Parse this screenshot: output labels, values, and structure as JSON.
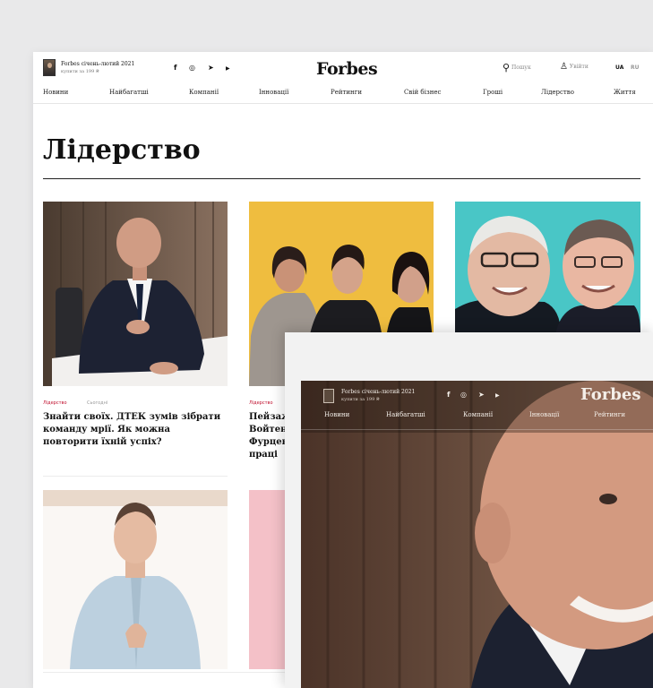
{
  "promo": {
    "title": "Forbes січень-лютий 2021",
    "subtitle": "купити за 199 ₴"
  },
  "social": {
    "facebook": "f",
    "instagram": "◎",
    "telegram": "➤",
    "youtube": "▶"
  },
  "logo": "Forbes",
  "search": {
    "icon": "search-icon",
    "label": "Пошук"
  },
  "login": {
    "icon": "user-icon",
    "label": "Увійти"
  },
  "lang": {
    "active": "UA",
    "other": "RU"
  },
  "nav": [
    "Новини",
    "Найбагатші",
    "Компанії",
    "Інновації",
    "Рейтинги",
    "Свій бізнес",
    "Гроші",
    "Лідерство",
    "Життя"
  ],
  "page_title": "Лідерство",
  "cards": [
    {
      "tag": "Лідерство",
      "date": "Сьогодні",
      "title_lines": [
        "Знайти своїх. ДТЕК зумів зібрати",
        "команду мрії. Як можна",
        "повторити їхній успіх?"
      ]
    },
    {
      "tag": "Лідерство",
      "title_lines": [
        "Пейзаж",
        "Войтен",
        "Фурцев",
        "праці"
      ]
    }
  ],
  "overlay": {
    "promo_title": "Forbes січень-лютий 2021",
    "promo_subtitle": "купити за 199 ₴",
    "logo": "Forbes",
    "nav": [
      "Новини",
      "Найбагатші",
      "Компанії",
      "Інновації",
      "Рейтинги"
    ]
  },
  "colors": {
    "accent": "#c0102e",
    "text": "#111111",
    "background": "#e9e9ea"
  }
}
